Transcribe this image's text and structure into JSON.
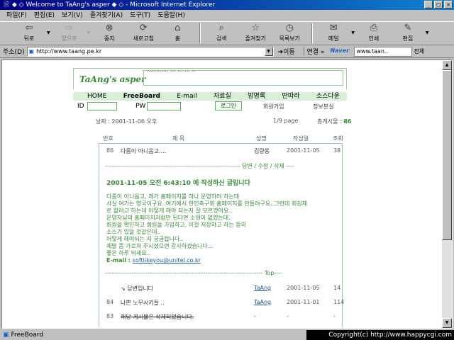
{
  "window": {
    "title": "◆ ◇ Welcome to TaAng's asper ◆ ◇ - Microsoft Internet Explorer",
    "icon": "ie-page-icon",
    "buttons": [
      "_",
      "□",
      "×"
    ]
  },
  "menu": [
    "파일(F)",
    "편집(E)",
    "보기(V)",
    "즐겨찾기(A)",
    "도구(T)",
    "도움말(H)"
  ],
  "toolbar": {
    "back": "뒤로",
    "forward": "앞으로",
    "stop": "중지",
    "refresh": "새로고침",
    "home": "홈",
    "search": "검색",
    "favorites": "즐겨찾기",
    "history": "목록보기",
    "mail": "메일",
    "print": "인쇄",
    "edit": "편집"
  },
  "address": {
    "label": "주소(D)",
    "url": "http://www.taang.pe.kr",
    "go": "이동",
    "links": "연결 »",
    "naver": "Naver",
    "search_value": "www.taan..",
    "search_scope": "전체"
  },
  "page": {
    "logo": "TaAng's asper",
    "marquee": "............  ...  ...  ...  ..",
    "nav": [
      "HOME",
      "FreeBoard",
      "E-mail",
      "자료실",
      "방명록",
      "딴따라",
      "소스다운"
    ],
    "nav_active": "FreeBoard",
    "login": {
      "id_label": "ID",
      "pw_label": "PW",
      "login_button": "로그인",
      "join": "회원가입",
      "info": "정보분실"
    },
    "date_info": "날짜 : 2001-11-06 오후",
    "page_info": "1/9 page",
    "total_label": "총게시물 :",
    "total_value": "86",
    "columns": [
      "번호",
      "제 목",
      "성명",
      "작성일",
      "조회"
    ],
    "rows": [
      {
        "num": "86",
        "title": "다름이 아니옵고....",
        "author": "김량용",
        "date": "2001-11-05",
        "views": "38",
        "link": false
      },
      {
        "num": "",
        "title": "↘ 답변입니다",
        "author": "TaAng",
        "date": "2001-11-05",
        "views": "14",
        "link": true
      },
      {
        "num": "84",
        "title": "나쁜 노무시키들 ..",
        "author": "TaAng",
        "date": "2001-11-01",
        "views": "114",
        "link": true
      },
      {
        "num": "83",
        "title": "해당 게시물은 삭제되었습니다.",
        "author": "-",
        "date": "-",
        "views": "-",
        "link": false,
        "strike": true
      }
    ],
    "post": {
      "reply_bar": "------------------------------------------------------------------ 답변 / 수정 / 삭제 ----",
      "date_line": "2001-11-05 오전 6:43:10 에 작성하신 글입니다",
      "body": [
        "다름이 아니옵고, 제가 홈페이지를 하나 운영하려 하는데",
        "사실 여기는 영국이구요..여기에서 한인축구회 홈페이지를 만들려구요..그런데 회원제",
        "로 할려고 하는데 어떻게 해야 되는지 잘 모르겠어요..",
        "운영자님의 홈페이지처럼만 된다면 소원이 없겠는데..",
        "회원을 확인하고 회원을 가입하고, 이걸 저장하고 하는 등의",
        "소스가 있을 것같은데..",
        "어떻게 해야되는 지 궁금합니다..",
        "제발 좀 가르쳐 주시셨으면 감사하겠습니다...",
        "좋은 하루 되세요.."
      ],
      "email_label": "E-mail :",
      "email": "softlikeyou@unitel.co.kr",
      "top_bar": "----------------------------------------------------------------------------- Top----"
    }
  },
  "status": {
    "text": "FreeBoard",
    "copyright": "Copyright(c) http://www.happycgi.com"
  }
}
